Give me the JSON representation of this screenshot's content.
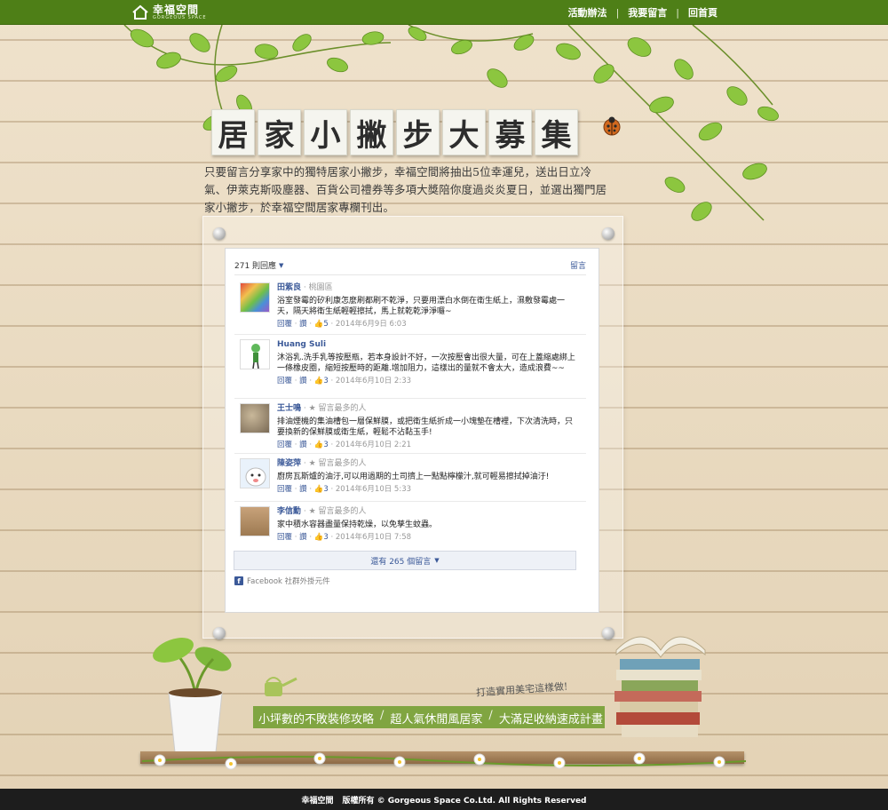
{
  "header": {
    "logo_name": "幸福空間",
    "logo_sub": "GORGEOUS SPACE",
    "nav": [
      {
        "label": "活動辦法"
      },
      {
        "label": "我要留言"
      },
      {
        "label": "回首頁"
      }
    ],
    "nav_separator": "|"
  },
  "title_chars": [
    "居",
    "家",
    "小",
    "撇",
    "步",
    "大",
    "募",
    "集"
  ],
  "intro": "只要留言分享家中的獨特居家小撇步，幸福空間將抽出5位幸運兒，送出日立冷氣、伊萊克斯吸塵器、百貨公司禮券等多項大獎陪你度過炎炎夏日，並選出獨門居家小撇步，於幸福空間居家專欄刊出。",
  "comments_panel": {
    "count_label": "271 則回應",
    "post_label": "留言",
    "comments": [
      {
        "name": "田紫良",
        "meta": " · 桃園區",
        "text": "浴室發霉的矽利康怎麼刷都刷不乾淨，只要用漂白水倒在衛生紙上，濕敷發霉處一天，隔天將衛生紙輕輕擦拭，馬上就乾乾淨淨囉~",
        "reply": "回覆",
        "like": "讚",
        "likes": "5",
        "date": "2014年6月9日 6:03"
      },
      {
        "name": "Huang Suli",
        "meta": "",
        "text": "沐浴乳.洗手乳等按壓瓶，若本身設計不好，一次按壓會出很大量，可在上蓋縮處綁上一條橡皮圈，縮短按壓時的距離.增加阻力，這樣出的量就不會太大，造成浪費~~",
        "reply": "回覆",
        "like": "讚",
        "likes": "3",
        "date": "2014年6月10日 2:33"
      },
      {
        "name": "王士鳴",
        "meta": " · ★ 留言最多的人",
        "text": "排油煙機的集油槽包一層保鮮膜，或把衛生紙折成一小塊墊在槽裡，下次清洗時，只要換新的保鮮膜或衛生紙，輕鬆不沾黏玉手!",
        "reply": "回覆",
        "like": "讚",
        "likes": "3",
        "date": "2014年6月10日 2:21"
      },
      {
        "name": "陳姿萍",
        "meta": " · ★ 留言最多的人",
        "text": "廚房瓦斯爐的油汙,可以用過期的土司擠上一點點檸檬汁,就可輕易擦拭掉油汙!",
        "reply": "回覆",
        "like": "讚",
        "likes": "3",
        "date": "2014年6月10日 5:33"
      },
      {
        "name": "李信勳",
        "meta": " · ★ 留言最多的人",
        "text": "家中積水容器盡量保持乾燥，以免孳生蚊蟲。",
        "reply": "回覆",
        "like": "讚",
        "likes": "3",
        "date": "2014年6月10日 7:58"
      }
    ],
    "more_label": "還有 265 個留言",
    "plugin_label": "Facebook 社群外掛元件"
  },
  "promo": {
    "tagline": "打造實用美宅這樣做!",
    "items": [
      "小坪數的不敗裝修攻略",
      "超人氣休閒風居家",
      "大滿足收納速成計畫"
    ],
    "separator": "/"
  },
  "footer": {
    "brand": "幸福空間",
    "rights": "版權所有 © Gorgeous Space Co.Ltd. All Rights Reserved"
  },
  "colors": {
    "topbar": "#4e7f17",
    "link": "#3b5998",
    "footer": "#1d1d1d"
  }
}
